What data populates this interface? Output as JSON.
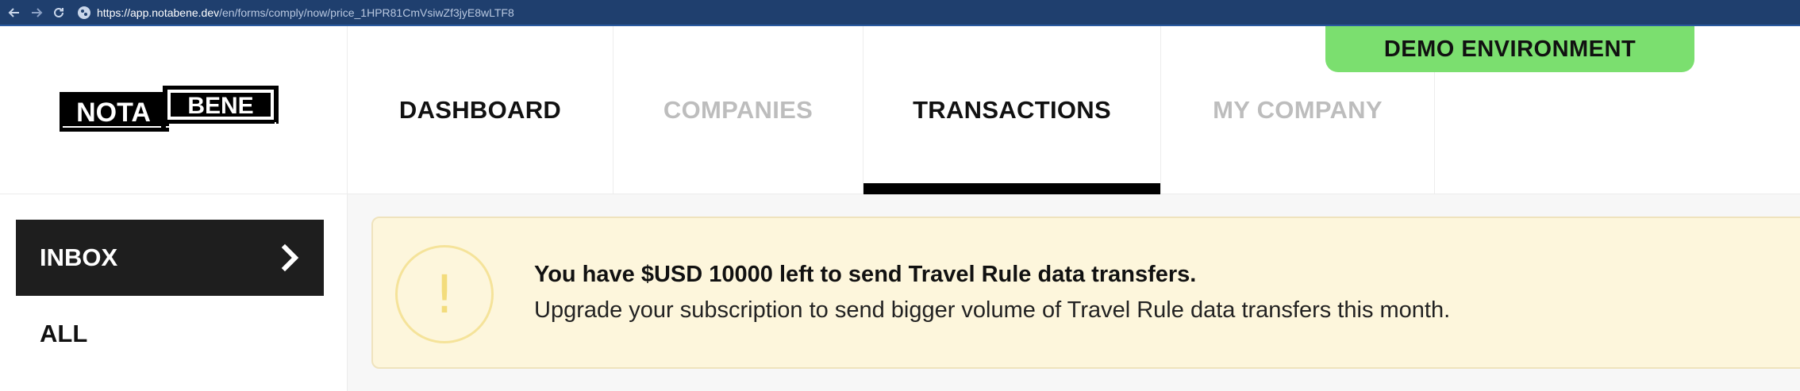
{
  "browser": {
    "url_host": "https://app.notabene.dev",
    "url_path": "/en/forms/comply/now/price_1HPR81CmVsiwZf3jyE8wLTF8",
    "back_icon": "arrow-left-icon",
    "forward_icon": "arrow-right-icon",
    "reload_icon": "reload-icon"
  },
  "logo": {
    "part1": "NOTA",
    "part2": "BENE"
  },
  "tabs": [
    {
      "label": "DASHBOARD",
      "active": false
    },
    {
      "label": "COMPANIES",
      "active": false
    },
    {
      "label": "TRANSACTIONS",
      "active": true
    },
    {
      "label": "MY COMPANY",
      "active": false
    }
  ],
  "demo_badge": "DEMO ENVIRONMENT",
  "sidebar": {
    "items": [
      {
        "label": "INBOX",
        "active": true,
        "icon": "chevron-right-icon"
      },
      {
        "label": "ALL",
        "active": false
      }
    ]
  },
  "alert": {
    "icon": "!",
    "title": "You have $USD 10000 left to send Travel Rule data transfers.",
    "text": "Upgrade your subscription to send bigger volume of Travel Rule data transfers this month."
  },
  "colors": {
    "browser_bar": "#1f3f6e",
    "demo_badge": "#7bdf6f",
    "alert_bg": "#fdf6dc",
    "alert_icon": "#f3dc7c",
    "active_tab_bar": "#000000",
    "sidebar_active": "#1e1e1e"
  }
}
